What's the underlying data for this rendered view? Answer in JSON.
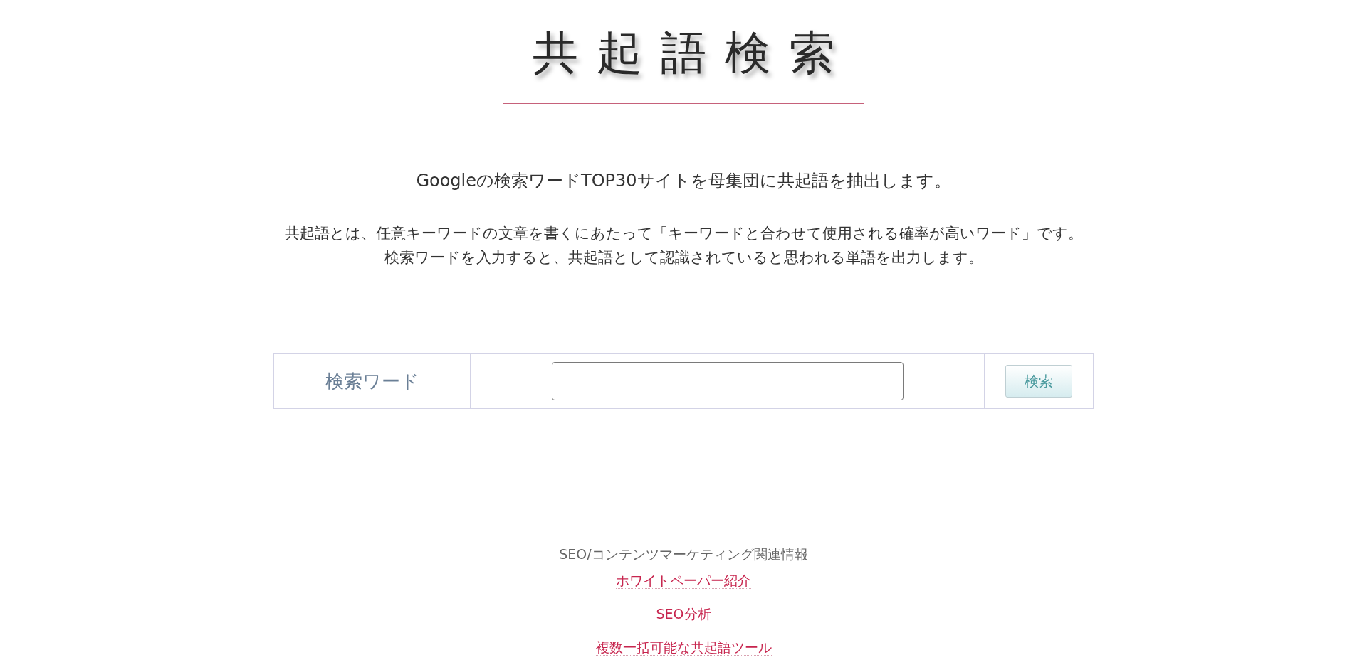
{
  "header": {
    "logo": "共起語検索"
  },
  "intro": {
    "headline": "Googleの検索ワードTOP30サイトを母集団に共起語を抽出します。",
    "description": [
      "共起語とは、任意キーワードの文章を書くにあたって「キーワードと合わせて使用される確率が高いワード」です。",
      "検索ワードを入力すると、共起語として認識されていると思われる単語を出力します。"
    ]
  },
  "search_form": {
    "label": "検索ワード",
    "button": "検索"
  },
  "footer": {
    "heading": "SEO/コンテンツマーケティング関連情報",
    "links": [
      "ホワイトペーパー紹介",
      "SEO分析",
      "複数一括可能な共起語ツール"
    ]
  }
}
